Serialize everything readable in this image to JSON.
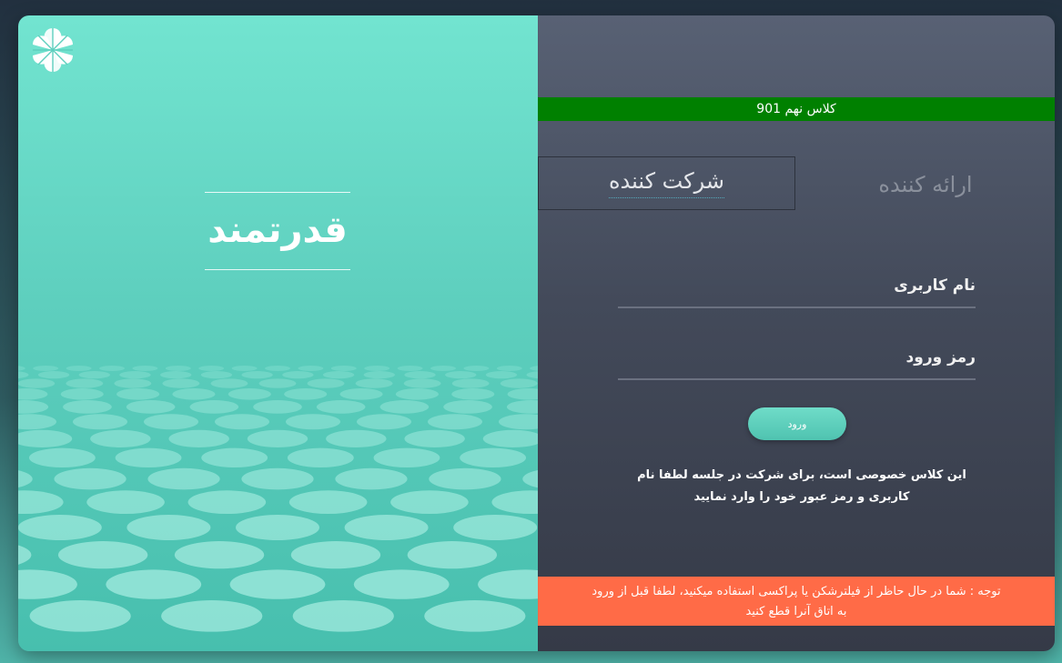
{
  "brand": {
    "title": "قدرتمند",
    "logo_icon": "flower-logo-icon"
  },
  "class_bar": {
    "text": "کلاس نهم 901",
    "color": "#008000"
  },
  "tabs": {
    "presenter": "ارائه کننده",
    "participant": "شرکت کننده",
    "active": "participant"
  },
  "form": {
    "username_placeholder": "نام کاربری",
    "password_placeholder": "رمز ورود",
    "login_label": "ورود"
  },
  "info": {
    "line1": "این کلاس خصوصی است، برای شرکت در جلسه لطفا نام",
    "line2": "کاربری و رمز عبور خود را وارد نمایید"
  },
  "warning": {
    "line1": "توجه : شما در حال حاظر از فیلترشکن یا پراکسی استفاده میکنید، لطفا قبل از ورود",
    "line2": "به اتاق آنرا قطع کنید",
    "color": "#ff6b47"
  },
  "colors": {
    "accent": "#5ecfbe",
    "panel": "#434a5a"
  }
}
